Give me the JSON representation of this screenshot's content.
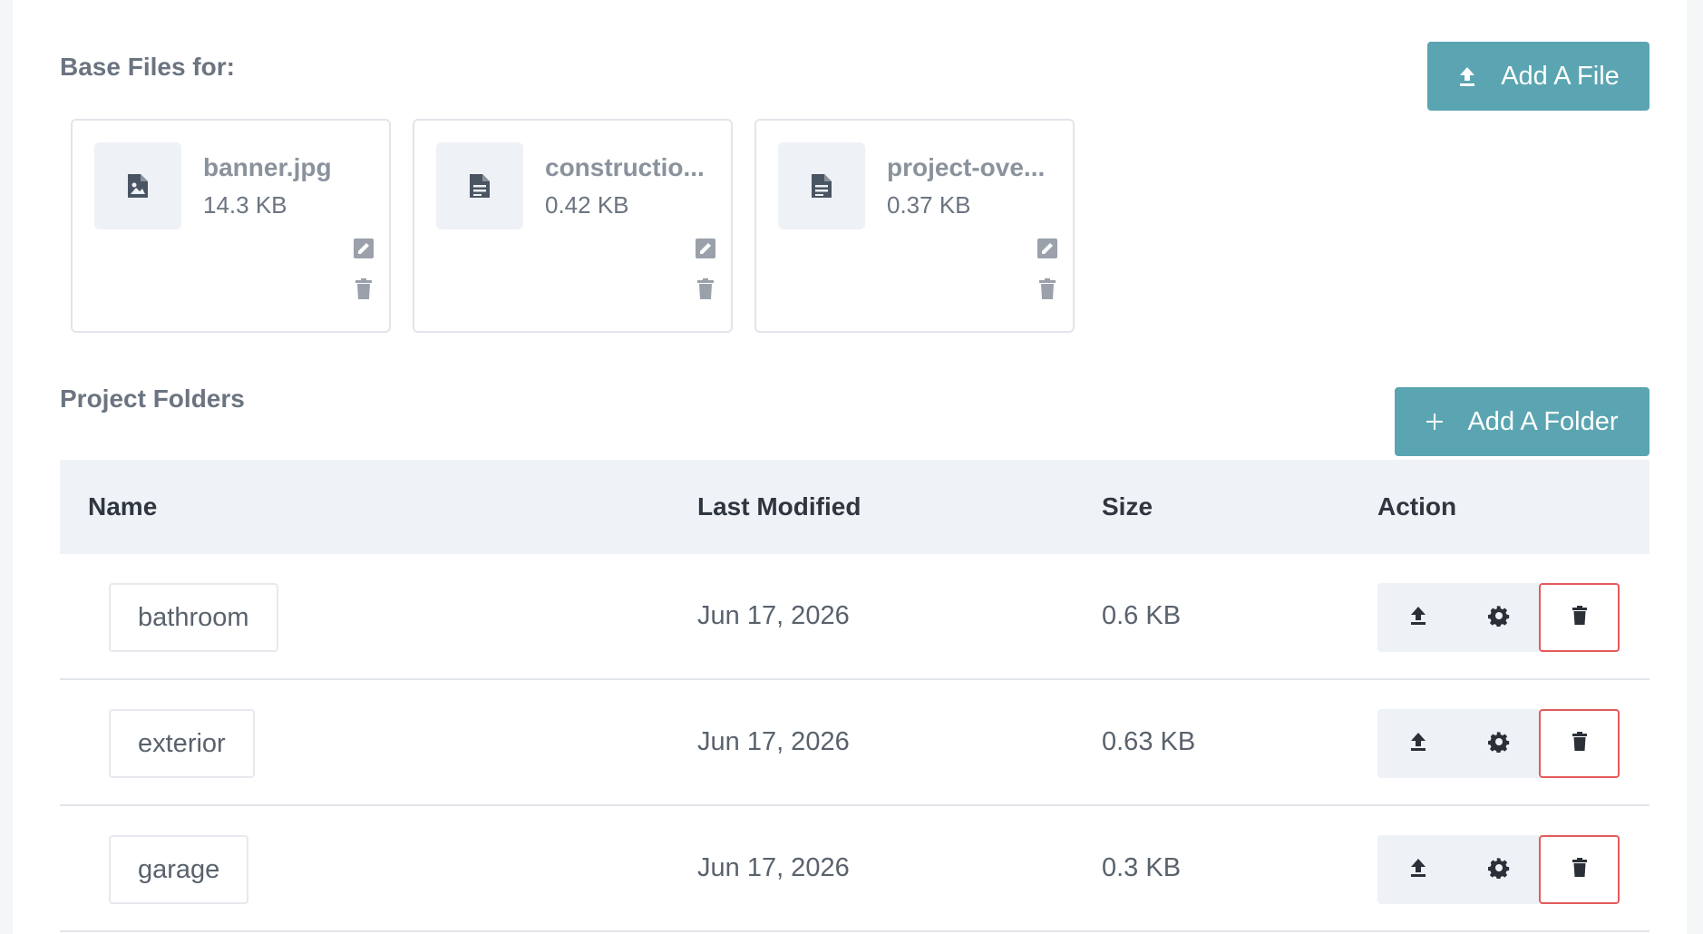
{
  "base_files": {
    "title": "Base Files for:",
    "add_button": "Add A File",
    "files": [
      {
        "name": "banner.jpg",
        "size": "14.3 KB",
        "icon": "image-file-icon"
      },
      {
        "name": "constructio...",
        "size": "0.42 KB",
        "icon": "document-file-icon"
      },
      {
        "name": "project-ove...",
        "size": "0.37 KB",
        "icon": "document-file-icon"
      }
    ]
  },
  "folders": {
    "title": "Project Folders",
    "add_button": "Add A Folder",
    "columns": [
      "Name",
      "Last Modified",
      "Size",
      "Action"
    ],
    "rows": [
      {
        "name": "bathroom",
        "modified": "Jun 17, 2026",
        "size": "0.6 KB"
      },
      {
        "name": "exterior",
        "modified": "Jun 17, 2026",
        "size": "0.63 KB"
      },
      {
        "name": "garage",
        "modified": "Jun 17, 2026",
        "size": "0.3 KB"
      }
    ]
  },
  "colors": {
    "accent": "#5aa5b1",
    "danger": "#e45b5b",
    "header_bg": "#eff2f6"
  }
}
